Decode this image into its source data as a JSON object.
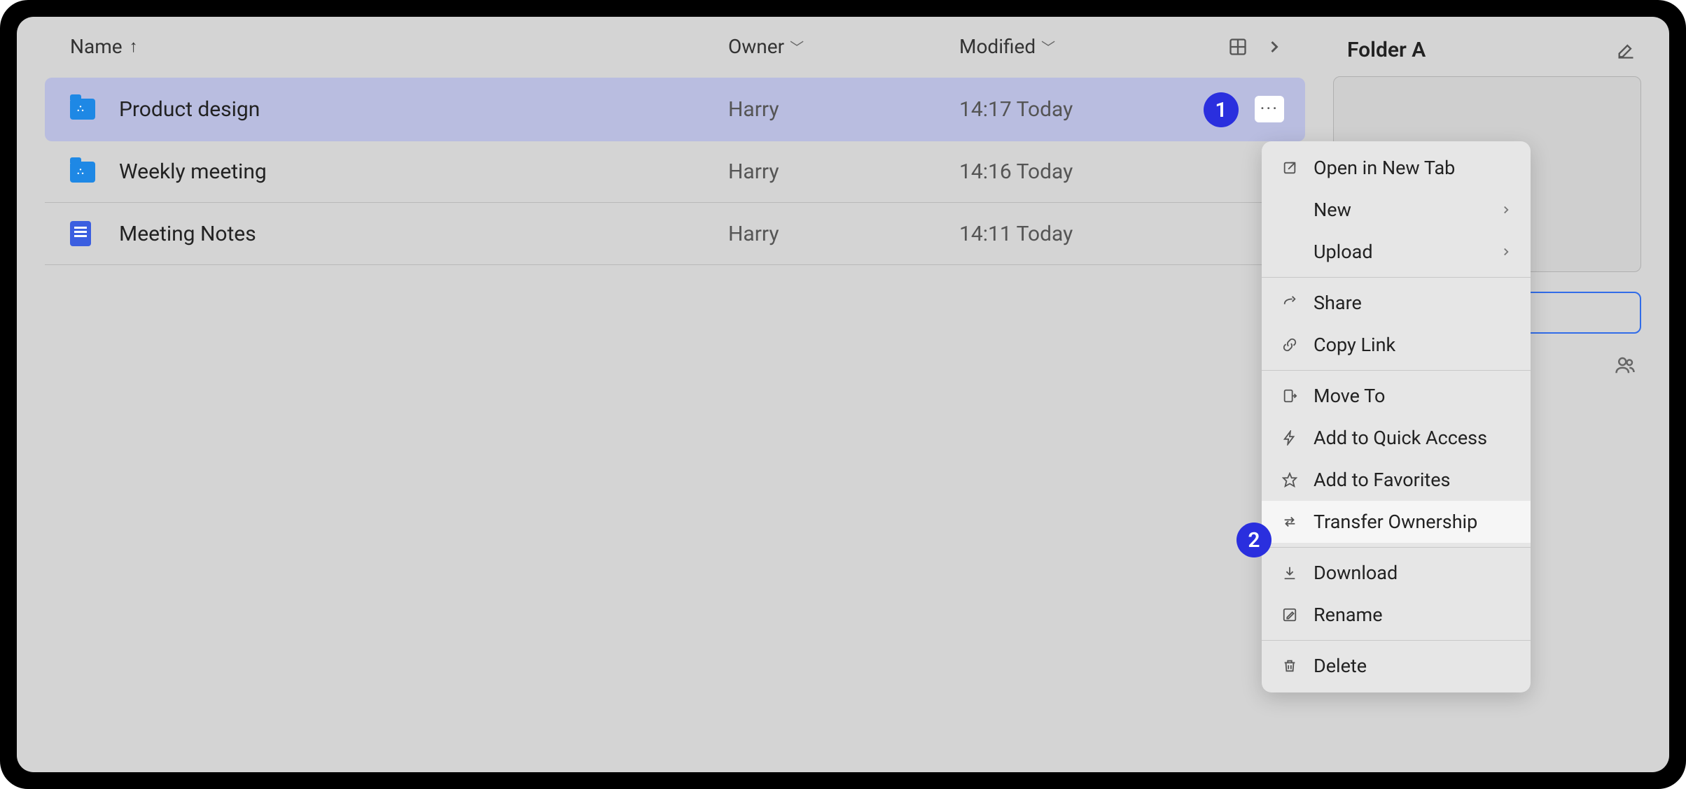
{
  "columns": {
    "name": "Name",
    "owner": "Owner",
    "modified": "Modified"
  },
  "rows": [
    {
      "type": "folder",
      "name": "Product design",
      "owner": "Harry",
      "modified": "14:17 Today",
      "selected": true
    },
    {
      "type": "folder",
      "name": "Weekly meeting",
      "owner": "Harry",
      "modified": "14:16 Today",
      "selected": false
    },
    {
      "type": "doc",
      "name": "Meeting Notes",
      "owner": "Harry",
      "modified": "14:11 Today",
      "selected": false
    }
  ],
  "side": {
    "title": "Folder A"
  },
  "menu": {
    "open_new_tab": "Open in New Tab",
    "new": "New",
    "upload": "Upload",
    "share": "Share",
    "copy_link": "Copy Link",
    "move_to": "Move To",
    "quick_access": "Add to Quick Access",
    "favorites": "Add to Favorites",
    "transfer": "Transfer Ownership",
    "download": "Download",
    "rename": "Rename",
    "delete": "Delete"
  },
  "callouts": {
    "one": "1",
    "two": "2"
  }
}
